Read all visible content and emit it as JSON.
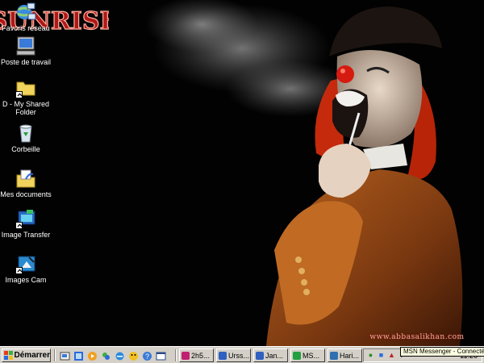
{
  "desktop": {
    "icons": [
      {
        "label": "Favoris réseau",
        "icon": "network-places-icon"
      },
      {
        "label": "Poste de travail",
        "icon": "my-computer-icon"
      },
      {
        "label": "D - My Shared Folder",
        "icon": "shared-folder-icon"
      },
      {
        "label": "Corbeille",
        "icon": "recycle-bin-icon"
      },
      {
        "label": "Mes documents",
        "icon": "my-documents-icon"
      },
      {
        "label": "Image Transfer",
        "icon": "image-transfer-icon"
      },
      {
        "label": "Images Cam",
        "icon": "images-cam-icon"
      }
    ]
  },
  "wallpaper": {
    "logo_text": "SUNRISE",
    "url": "www.abbasalikhan.com"
  },
  "taskbar": {
    "start_label": "Démarrer",
    "quick_launch": [
      "desktop-icon",
      "ie-icon",
      "media-player-icon",
      "messenger-icon",
      "ie-e-icon",
      "smiley-icon",
      "help-icon",
      "window-icon"
    ],
    "tasks": [
      {
        "label": "2h5...",
        "color": "#c02070"
      },
      {
        "label": "Urss...",
        "color": "#3060c0"
      },
      {
        "label": "Jan...",
        "color": "#3060c0"
      },
      {
        "label": "MS...",
        "color": "#20a040"
      },
      {
        "label": "Hari...",
        "color": "#3070b0"
      }
    ],
    "clock": "11:26"
  },
  "tooltip": "MSN Messenger - Connecté"
}
